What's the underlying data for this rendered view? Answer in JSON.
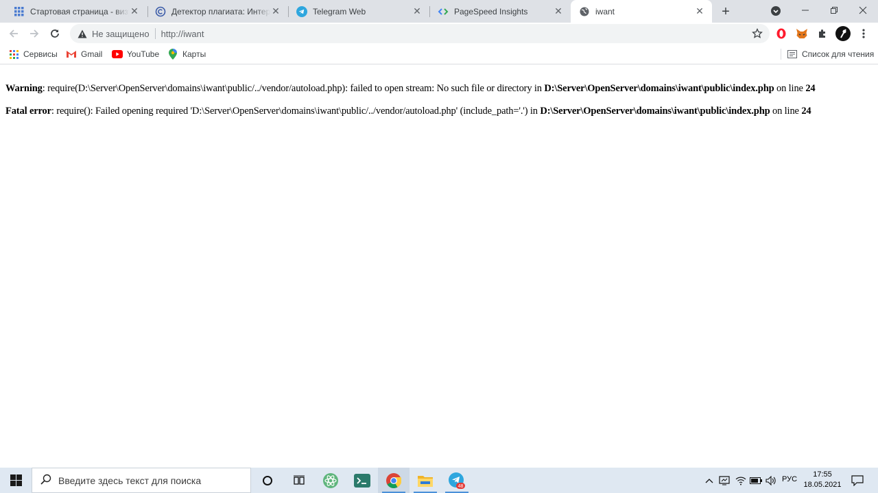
{
  "tabs": [
    {
      "title": "Стартовая страница - визуальные закладки",
      "icon": "grid-apps-icon",
      "active": false
    },
    {
      "title": "Детектор плагиата: Интернет",
      "icon": "copyright-c-icon",
      "active": false
    },
    {
      "title": "Telegram Web",
      "icon": "telegram-icon",
      "active": false
    },
    {
      "title": "PageSpeed Insights",
      "icon": "pagespeed-icon",
      "active": false
    },
    {
      "title": "iwant",
      "icon": "globe-icon",
      "active": true
    }
  ],
  "toolbar": {
    "security_label": "Не защищено",
    "url": "http://iwant"
  },
  "bookmarks": [
    {
      "label": "Сервисы",
      "icon": "apps-grid-icon"
    },
    {
      "label": "Gmail",
      "icon": "gmail-icon"
    },
    {
      "label": "YouTube",
      "icon": "youtube-icon"
    },
    {
      "label": "Карты",
      "icon": "maps-pin-icon"
    }
  ],
  "reading_list": "Список для чтения",
  "page": {
    "warning": {
      "label": "Warning",
      "text1": ": require(D:\\Server\\OpenServer\\domains\\iwant\\public/../vendor/autoload.php): failed to open stream: No such file or directory in ",
      "path": "D:\\Server\\OpenServer\\domains\\iwant\\public\\index.php",
      "text2": " on line ",
      "line": "24"
    },
    "fatal": {
      "label": "Fatal error",
      "text1": ": require(): Failed opening required 'D:\\Server\\OpenServer\\domains\\iwant\\public/../vendor/autoload.php' (include_path='.') in ",
      "path": "D:\\Server\\OpenServer\\domains\\iwant\\public\\index.php",
      "text2": " on line ",
      "line": "24"
    }
  },
  "taskbar": {
    "search_placeholder": "Введите здесь текст для поиска",
    "language": "РУС",
    "time": "17:55",
    "date": "18.05.2021",
    "telegram_badge": "48"
  }
}
